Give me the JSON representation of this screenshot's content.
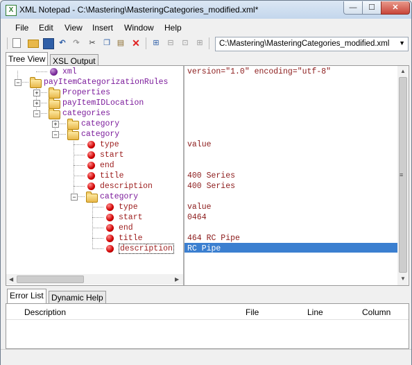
{
  "window": {
    "title": "XML Notepad - C:\\Mastering\\MasteringCategories_modified.xml*",
    "icon": "xml-notepad-app-icon"
  },
  "caption_buttons": {
    "minimize": "—",
    "maximize": "☐",
    "close": "✕"
  },
  "menu": [
    "File",
    "Edit",
    "View",
    "Insert",
    "Window",
    "Help"
  ],
  "toolbar": {
    "path_value": "C:\\Mastering\\MasteringCategories_modified.xml",
    "icons": [
      "new-icon",
      "open-icon",
      "save-icon",
      "undo-icon",
      "redo-icon",
      "cut-icon",
      "copy-icon",
      "paste-icon",
      "delete-icon",
      "nudge-icon",
      "indent-icon",
      "outdent-icon",
      "collapse-icon"
    ]
  },
  "tabs": {
    "tree_view": "Tree View",
    "xsl_output": "XSL Output"
  },
  "tree": [
    {
      "label": "xml",
      "kind": "pi",
      "value": "version=\"1.0\" encoding=\"utf-8\""
    },
    {
      "label": "payItemCategorizationRules",
      "kind": "folder",
      "expander": "−",
      "value": ""
    },
    {
      "label": "Properties",
      "kind": "folder",
      "expander": "+",
      "value": ""
    },
    {
      "label": "payItemIDLocation",
      "kind": "folder",
      "expander": "+",
      "value": ""
    },
    {
      "label": "categories",
      "kind": "folder",
      "expander": "−",
      "value": ""
    },
    {
      "label": "category",
      "kind": "folder",
      "expander": "+",
      "value": ""
    },
    {
      "label": "category",
      "kind": "folder",
      "expander": "−",
      "value": ""
    },
    {
      "label": "type",
      "kind": "leaf",
      "value": "value"
    },
    {
      "label": "start",
      "kind": "leaf",
      "value": ""
    },
    {
      "label": "end",
      "kind": "leaf",
      "value": ""
    },
    {
      "label": "title",
      "kind": "leaf",
      "value": "400 Series"
    },
    {
      "label": "description",
      "kind": "leaf",
      "value": "400 Series"
    },
    {
      "label": "category",
      "kind": "folder",
      "expander": "−",
      "value": ""
    },
    {
      "label": "type",
      "kind": "leaf",
      "value": "value"
    },
    {
      "label": "start",
      "kind": "leaf",
      "value": "0464"
    },
    {
      "label": "end",
      "kind": "leaf",
      "value": ""
    },
    {
      "label": "title",
      "kind": "leaf",
      "value": "464 RC Pipe"
    },
    {
      "label": "description",
      "kind": "leaf",
      "value": "RC Pipe",
      "selected": true
    }
  ],
  "bottom_tabs": {
    "error_list": "Error List",
    "dynamic_help": "Dynamic Help"
  },
  "error_columns": {
    "description": "Description",
    "file": "File",
    "line": "Line",
    "column": "Column"
  },
  "colors": {
    "selection": "#3b7fd0",
    "folder_label": "#7b1b9b",
    "leaf_label": "#9b1b1b",
    "value_text": "#8b1a1a"
  }
}
